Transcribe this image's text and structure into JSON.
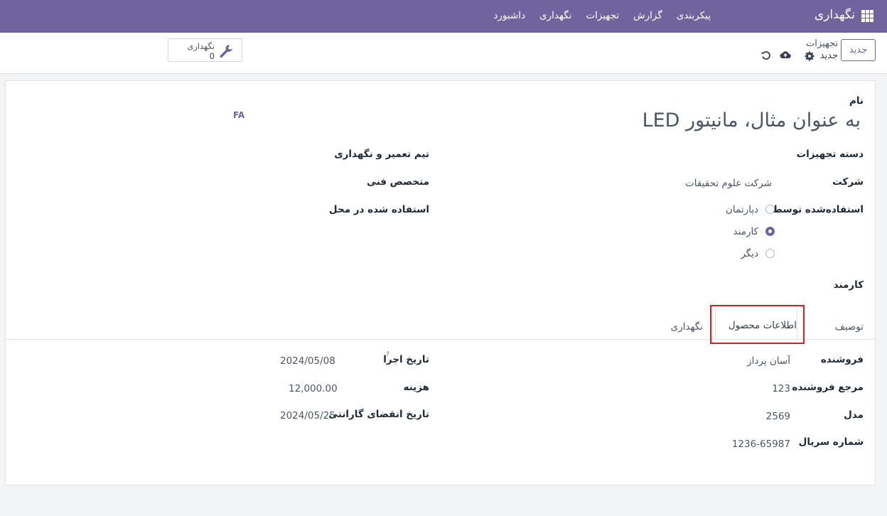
{
  "nav": {
    "brand": "نگهداری",
    "menu": [
      "داشبورد",
      "نگهداری",
      "تجهیزات",
      "گزارش",
      "پیکربندی"
    ]
  },
  "control": {
    "new_label": "جدید",
    "breadcrumb_parent": "تجهیزات",
    "breadcrumb_current": "جدید",
    "smart_button": {
      "label": "نگهداری",
      "count": "0"
    }
  },
  "form": {
    "name_label": "نام",
    "name_placeholder": "به عنوان مثال، مانیتور LED",
    "lang_button": "FA",
    "category_label": "دسته تجهیزات",
    "company_label": "شرکت",
    "company_value": "شرکت علوم تحقیقات",
    "used_by_label": "استفاده‌شده توسط",
    "used_by_options": [
      "دپارتمان",
      "کارمند",
      "دیگر"
    ],
    "used_by_selected": "کارمند",
    "employee_label": "کارمند",
    "team_label": "تیم تعمیر و نگهداری",
    "technician_label": "متخصص فنی",
    "location_label": "استفاده شده در محل"
  },
  "tabs": [
    "توصیف",
    "اطلاعات محصول",
    "نگهداری"
  ],
  "active_tab": "اطلاعات محصول",
  "product_info": {
    "vendor_label": "فروشنده",
    "vendor_value": "آسان پرداز",
    "vendor_ref_label": "مرجع فروشنده",
    "vendor_ref_value": "123",
    "model_label": "مدل",
    "model_value": "2569",
    "serial_label": "شماره سریال",
    "serial_value": "1236-65987",
    "effective_date_label": "تاریخ اجرا",
    "effective_date_help": "?",
    "effective_date_value": "2024/05/08",
    "cost_label": "هزینه",
    "cost_value": "12,000.00",
    "warranty_label": "تاریخ انقضای گارانتی",
    "warranty_value": "2024/05/25"
  },
  "colors": {
    "brand": "#71639e",
    "highlight": "#e01b24"
  }
}
